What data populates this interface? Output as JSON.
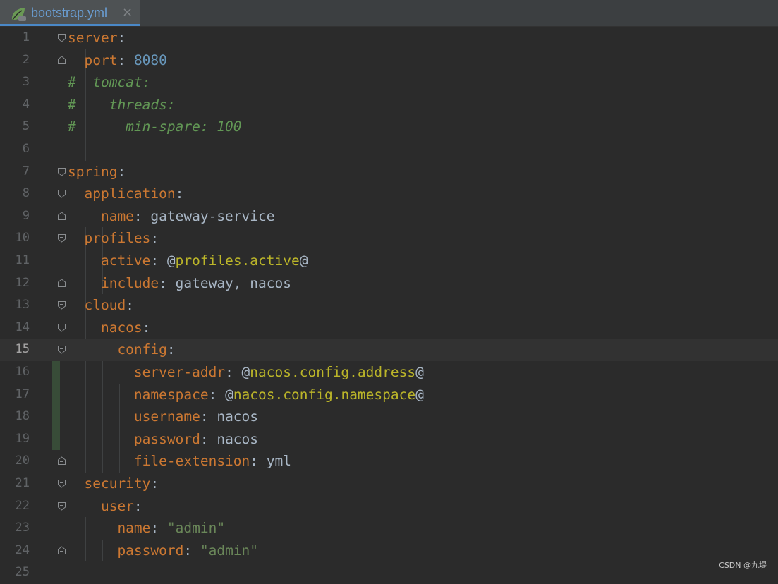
{
  "tab": {
    "title": "bootstrap.yml",
    "close_glyph": "×",
    "icon": "spring-leaf-icon",
    "accent_color": "#4a88c7"
  },
  "editor": {
    "current_line": 15,
    "lines": [
      {
        "number": "1",
        "parts": [
          {
            "t": "server",
            "c": "key"
          },
          {
            "t": ":",
            "c": "plain"
          }
        ]
      },
      {
        "number": "2",
        "parts": [
          {
            "t": "  port",
            "c": "key"
          },
          {
            "t": ": ",
            "c": "plain"
          },
          {
            "t": "8080",
            "c": "num"
          }
        ]
      },
      {
        "number": "3",
        "parts": [
          {
            "t": "#  tomcat:",
            "c": "comment"
          }
        ]
      },
      {
        "number": "4",
        "parts": [
          {
            "t": "#    threads:",
            "c": "comment"
          }
        ]
      },
      {
        "number": "5",
        "parts": [
          {
            "t": "#      min-spare: 100",
            "c": "comment"
          }
        ]
      },
      {
        "number": "6",
        "parts": []
      },
      {
        "number": "7",
        "parts": [
          {
            "t": "spring",
            "c": "key"
          },
          {
            "t": ":",
            "c": "plain"
          }
        ]
      },
      {
        "number": "8",
        "parts": [
          {
            "t": "  application",
            "c": "key"
          },
          {
            "t": ":",
            "c": "plain"
          }
        ]
      },
      {
        "number": "9",
        "parts": [
          {
            "t": "    name",
            "c": "key"
          },
          {
            "t": ": gateway-service",
            "c": "plain"
          }
        ]
      },
      {
        "number": "10",
        "parts": [
          {
            "t": "  profiles",
            "c": "key"
          },
          {
            "t": ":",
            "c": "plain"
          }
        ]
      },
      {
        "number": "11",
        "parts": [
          {
            "t": "    active",
            "c": "key"
          },
          {
            "t": ": @",
            "c": "plain"
          },
          {
            "t": "profiles.active",
            "c": "ann"
          },
          {
            "t": "@",
            "c": "plain"
          }
        ]
      },
      {
        "number": "12",
        "parts": [
          {
            "t": "    include",
            "c": "key"
          },
          {
            "t": ": gateway, nacos",
            "c": "plain"
          }
        ]
      },
      {
        "number": "13",
        "parts": [
          {
            "t": "  cloud",
            "c": "key"
          },
          {
            "t": ":",
            "c": "plain"
          }
        ]
      },
      {
        "number": "14",
        "parts": [
          {
            "t": "    nacos",
            "c": "key"
          },
          {
            "t": ":",
            "c": "plain"
          }
        ]
      },
      {
        "number": "15",
        "parts": [
          {
            "t": "      config",
            "c": "key"
          },
          {
            "t": ":",
            "c": "plain"
          }
        ]
      },
      {
        "number": "16",
        "parts": [
          {
            "t": "        server-addr",
            "c": "key"
          },
          {
            "t": ": @",
            "c": "plain"
          },
          {
            "t": "nacos.config.address",
            "c": "ann"
          },
          {
            "t": "@",
            "c": "plain"
          }
        ]
      },
      {
        "number": "17",
        "parts": [
          {
            "t": "        namespace",
            "c": "key"
          },
          {
            "t": ": @",
            "c": "plain"
          },
          {
            "t": "nacos.config.namespace",
            "c": "ann"
          },
          {
            "t": "@",
            "c": "plain"
          }
        ]
      },
      {
        "number": "18",
        "parts": [
          {
            "t": "        username",
            "c": "key"
          },
          {
            "t": ": nacos",
            "c": "plain"
          }
        ]
      },
      {
        "number": "19",
        "parts": [
          {
            "t": "        password",
            "c": "key"
          },
          {
            "t": ": nacos",
            "c": "plain"
          }
        ]
      },
      {
        "number": "20",
        "parts": [
          {
            "t": "        file-extension",
            "c": "key"
          },
          {
            "t": ": yml",
            "c": "plain"
          }
        ]
      },
      {
        "number": "21",
        "parts": [
          {
            "t": "  security",
            "c": "key"
          },
          {
            "t": ":",
            "c": "plain"
          }
        ]
      },
      {
        "number": "22",
        "parts": [
          {
            "t": "    user",
            "c": "key"
          },
          {
            "t": ":",
            "c": "plain"
          }
        ]
      },
      {
        "number": "23",
        "parts": [
          {
            "t": "      name",
            "c": "key"
          },
          {
            "t": ": ",
            "c": "plain"
          },
          {
            "t": "\"admin\"",
            "c": "str"
          }
        ]
      },
      {
        "number": "24",
        "parts": [
          {
            "t": "      password",
            "c": "key"
          },
          {
            "t": ": ",
            "c": "plain"
          },
          {
            "t": "\"admin\"",
            "c": "str"
          }
        ]
      },
      {
        "number": "25",
        "parts": []
      }
    ],
    "fold_open_lines": [
      1,
      7,
      8,
      10,
      13,
      14,
      15,
      21,
      22
    ],
    "fold_end_lines": [
      2,
      9,
      12,
      20,
      24
    ],
    "modified_lines": [
      16,
      17,
      18,
      19
    ]
  },
  "watermark": "CSDN @九堤",
  "colors": {
    "background": "#2b2b2b",
    "keyword": "#cc7832",
    "number": "#6897bb",
    "string": "#6a8759",
    "comment": "#629755",
    "annotation": "#bbb529",
    "plain": "#a9b7c6",
    "modified_marker": "#384c38"
  }
}
